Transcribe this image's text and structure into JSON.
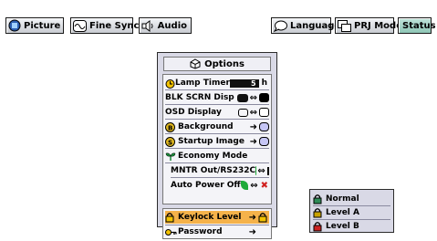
{
  "tabs": [
    {
      "label": "Picture",
      "icon": "picture-icon"
    },
    {
      "label": "Fine Sync",
      "icon": "fine-sync-icon"
    },
    {
      "label": "Audio",
      "icon": "speaker-icon"
    },
    {
      "label": "Language",
      "icon": "speech-bubble-icon"
    },
    {
      "label": "PRJ Mode",
      "icon": "projector-icon"
    },
    {
      "label": "Status",
      "icon": ""
    }
  ],
  "options_menu": {
    "title": "Options",
    "items": [
      {
        "label": "Lamp Timer",
        "value": "5",
        "unit": "h"
      },
      {
        "label": "BLK SCRN Disp"
      },
      {
        "label": "OSD Display"
      },
      {
        "label": "Background"
      },
      {
        "label": "Startup Image"
      },
      {
        "label": "Economy Mode"
      },
      {
        "label": "MNTR Out/RS232C"
      },
      {
        "label": "Auto Power Off"
      }
    ],
    "lower_items": [
      {
        "label": "Keylock Level",
        "selected": true
      },
      {
        "label": "Password"
      }
    ]
  },
  "keylock_submenu": {
    "items": [
      {
        "label": "Normal",
        "lock_color": "#2e8b57"
      },
      {
        "label": "Level A",
        "lock_color": "#c8a200"
      },
      {
        "label": "Level B",
        "lock_color": "#cc2020"
      }
    ]
  },
  "colors": {
    "selected_row": "#f5b24a",
    "menu_bg": "#d9d9e6"
  }
}
